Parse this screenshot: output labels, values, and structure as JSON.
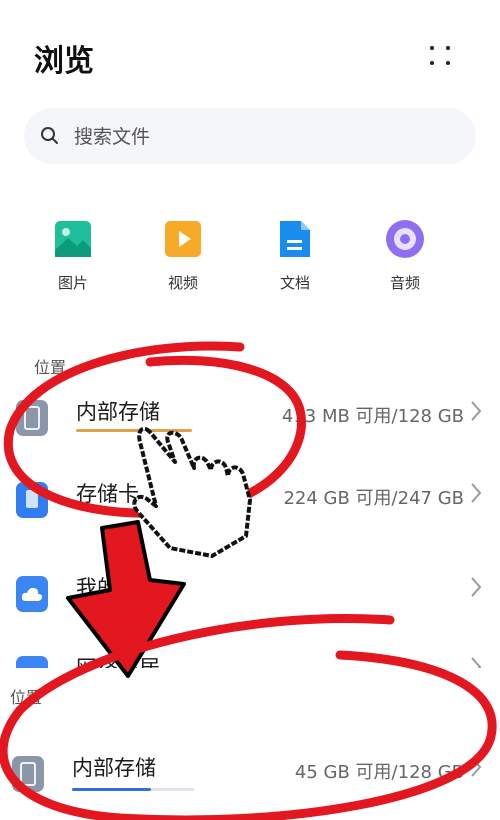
{
  "header": {
    "title": "浏览"
  },
  "search": {
    "placeholder": "搜索文件"
  },
  "categories": [
    {
      "label": "图片",
      "icon": "image-icon",
      "color": "#1fbf9a"
    },
    {
      "label": "视频",
      "icon": "video-icon",
      "color": "#f7a928"
    },
    {
      "label": "文档",
      "icon": "document-icon",
      "color": "#1a8cf0"
    },
    {
      "label": "音频",
      "icon": "audio-icon",
      "color": "#8f6ff0"
    }
  ],
  "locations": {
    "label": "位置",
    "items": [
      {
        "name": "内部存储",
        "capacity": "413 MB 可用/128 GB",
        "used_fraction": 0.997
      },
      {
        "name": "存储卡",
        "capacity": "224 GB 可用/247 GB"
      },
      {
        "name": "我的云盘",
        "capacity": ""
      },
      {
        "name": "网络邻居",
        "capacity": ""
      }
    ]
  },
  "zoomed": {
    "label": "位置",
    "item": {
      "name": "内部存储",
      "capacity": "45 GB 可用/128 GB",
      "used_fraction": 0.65
    }
  },
  "colors": {
    "accent": "#2f6fe4",
    "warning_bar": "#e2a04a",
    "annotation_red": "#e3171f"
  }
}
